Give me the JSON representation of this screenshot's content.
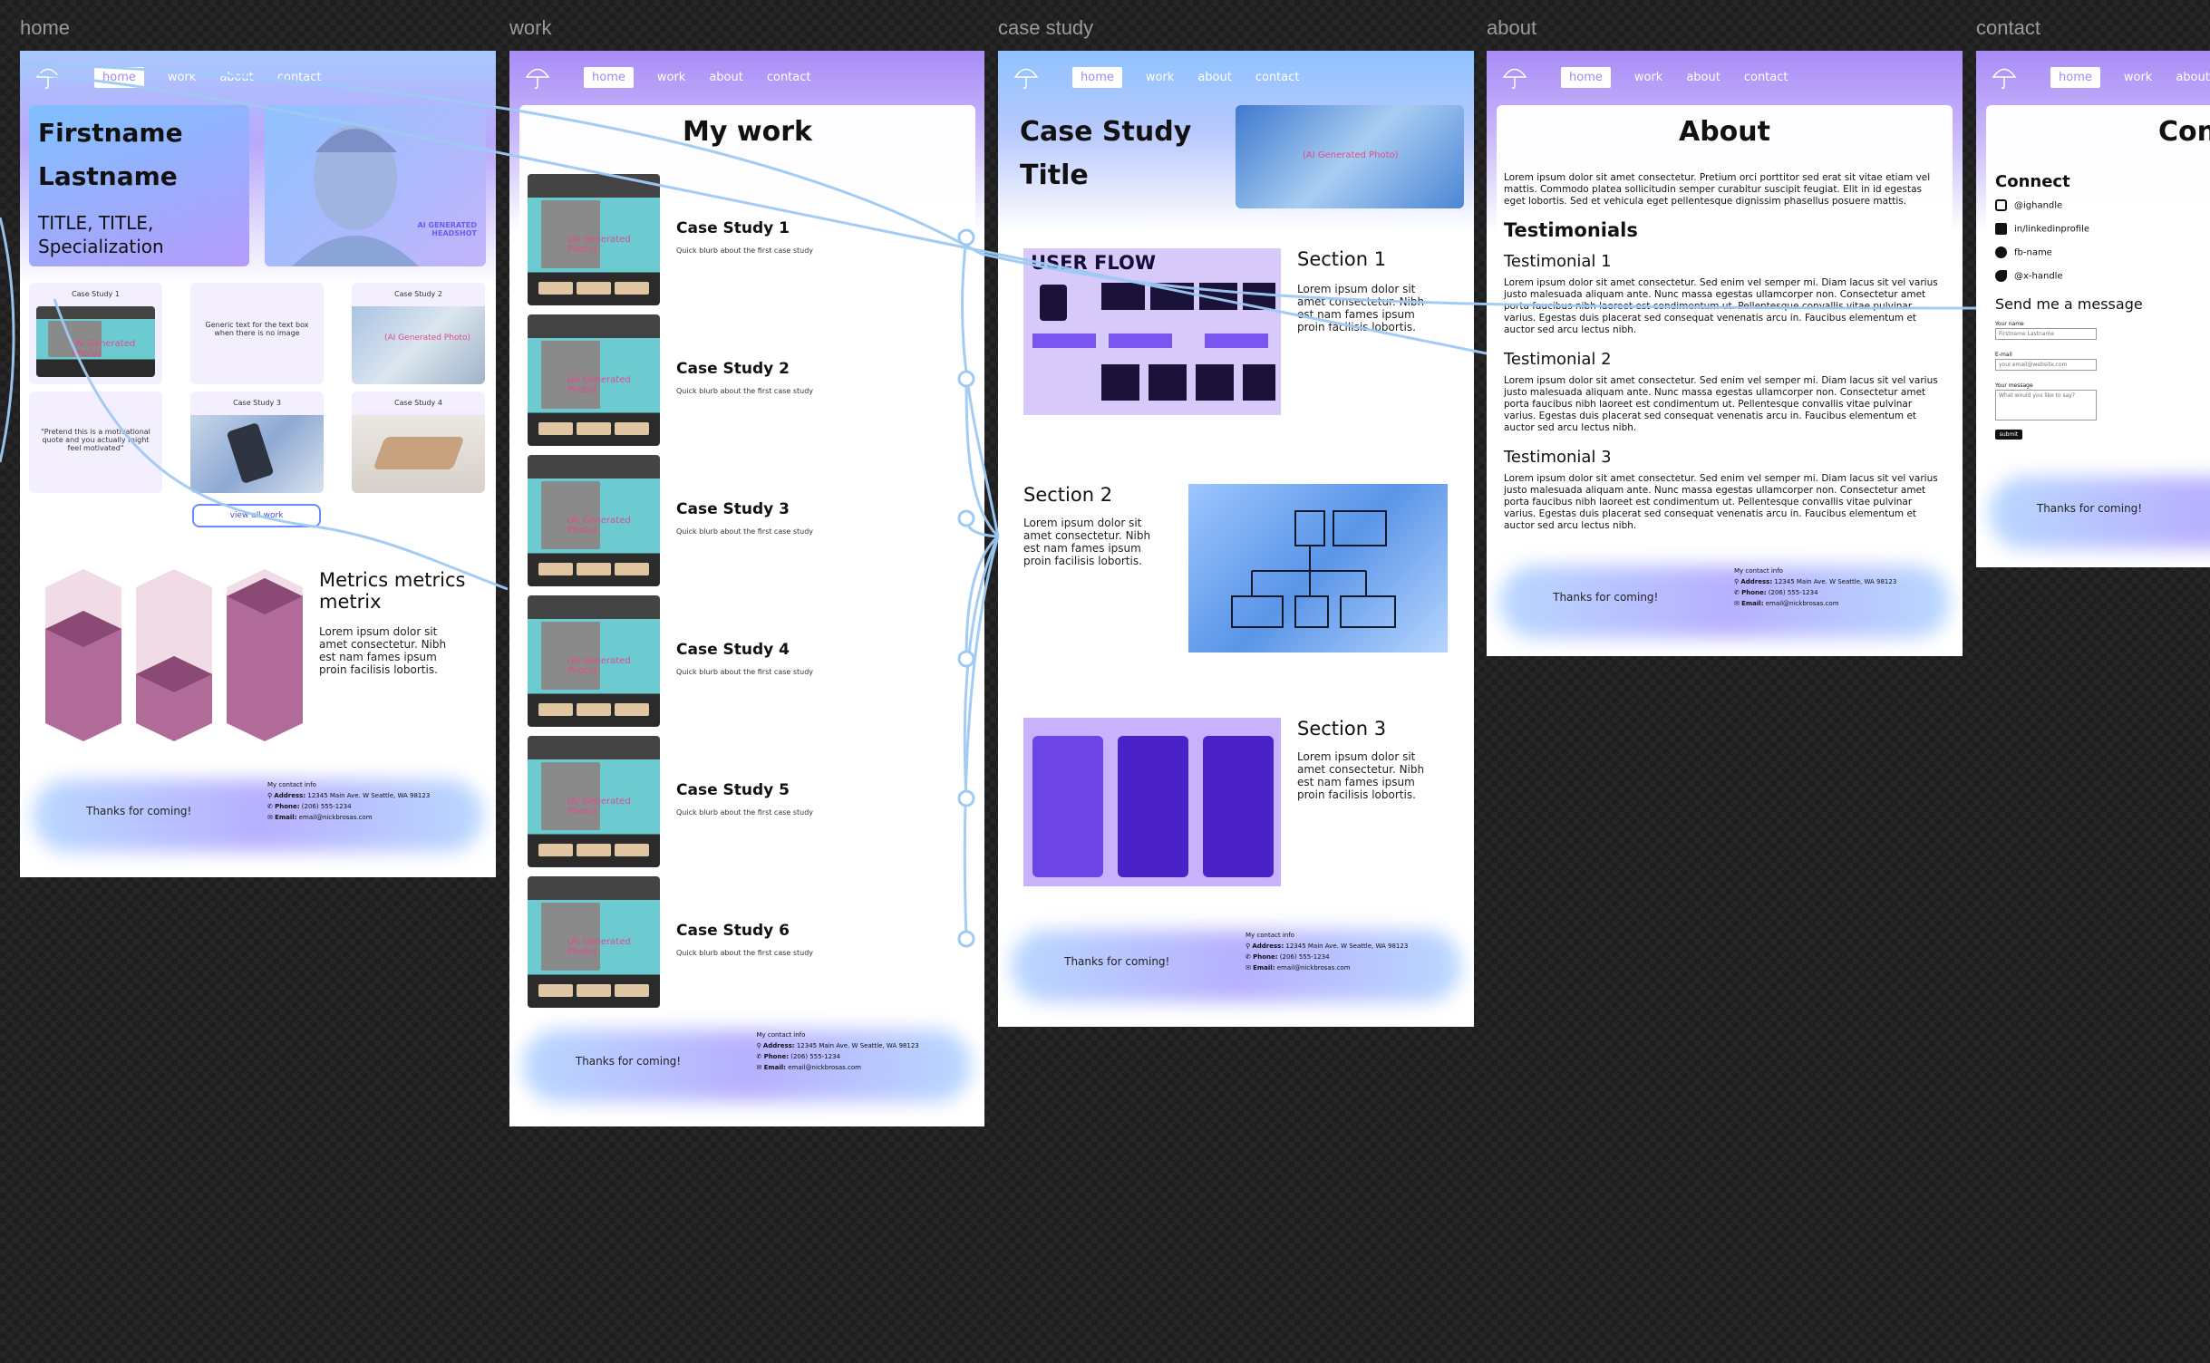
{
  "canvas": {
    "frame_labels": [
      "home",
      "work",
      "case study",
      "about",
      "contact"
    ]
  },
  "nav": {
    "links": [
      "home",
      "work",
      "about",
      "contact"
    ]
  },
  "footer": {
    "thanks": "Thanks for coming!",
    "heading": "My contact info",
    "address_label": "Address:",
    "address": "12345 Main Ave. W Seattle, WA 98123",
    "phone_label": "Phone:",
    "phone": "(206) 555-1234",
    "email_label": "Email:",
    "email": "email@nickbrosas.com"
  },
  "home": {
    "name_line1": "Firstname",
    "name_line2": "Lastname",
    "titles": "TITLE, TITLE,",
    "specialization": "Specialization",
    "headshot_label": "AI GENERATED HEADSHOT",
    "case1": "Case Study 1",
    "case2": "Case Study 2",
    "case3": "Case Study 3",
    "case4": "Case Study 4",
    "generic_text": "Generic text for the text box when there is no image",
    "quote": "\"Pretend this is a motivational quote and you actually might feel motivated\"",
    "ai_photo": "(AI Generated Photo)",
    "view_all": "view all work",
    "metrics_title": "Metrics metrics metrix",
    "metrics_body": "Lorem ipsum dolor sit amet consectetur. Nibh est nam fames ipsum proin facilisis lobortis."
  },
  "work": {
    "title": "My work",
    "ai_photo": "(AI Generated Photo)",
    "items": [
      {
        "title": "Case Study 1",
        "blurb": "Quick blurb about the first case study"
      },
      {
        "title": "Case Study 2",
        "blurb": "Quick blurb about the first case study"
      },
      {
        "title": "Case Study 3",
        "blurb": "Quick blurb about the first case study"
      },
      {
        "title": "Case Study 4",
        "blurb": "Quick blurb about the first case study"
      },
      {
        "title": "Case Study 5",
        "blurb": "Quick blurb about the first case study"
      },
      {
        "title": "Case Study 6",
        "blurb": "Quick blurb about the first case study"
      }
    ]
  },
  "casestudy": {
    "title_line1": "Case Study",
    "title_line2": "Title",
    "ai_photo": "(AI Generated Photo)",
    "user_flow": "USER FLOW",
    "section1": "Section 1",
    "section2": "Section 2",
    "section3": "Section 3",
    "lorem": "Lorem ipsum dolor sit amet consectetur. Nibh est nam fames ipsum proin facilisis lobortis."
  },
  "about": {
    "title": "About",
    "intro": "Lorem ipsum dolor sit amet consectetur. Pretium orci porttitor sed erat sit vitae etiam vel mattis. Commodo platea sollicitudin semper curabitur suscipit feugiat. Elit in id egestas eget lobortis. Sed et vehicula eget pellentesque dignissim phasellus posuere mattis.",
    "testimonials": "Testimonials",
    "t1": "Testimonial 1",
    "t2": "Testimonial 2",
    "t3": "Testimonial 3",
    "t_body": "Lorem ipsum dolor sit amet consectetur. Sed enim vel semper mi. Diam lacus sit vel varius justo malesuada aliquam ante. Nunc massa egestas ullamcorper non. Consectetur amet porta faucibus nibh laoreet est condimentum ut. Pellentesque convallis vitae pulvinar varius. Egestas duis placerat sed consequat venenatis arcu in. Faucibus elementum et auctor sed arcu lectus nibh."
  },
  "contact": {
    "title": "Con",
    "connect": "Connect",
    "ig": "@ighandle",
    "li": "in/linkedinprofile",
    "fb": "fb-name",
    "x": "@x-handle",
    "send": "Send me a message",
    "name_label": "Your name",
    "name_ph": "Firstname Lastname",
    "email_label": "E-mail",
    "email_ph": "your.email@website.com",
    "msg_label": "Your message",
    "msg_ph": "What would you like to say?",
    "submit": "submit"
  }
}
